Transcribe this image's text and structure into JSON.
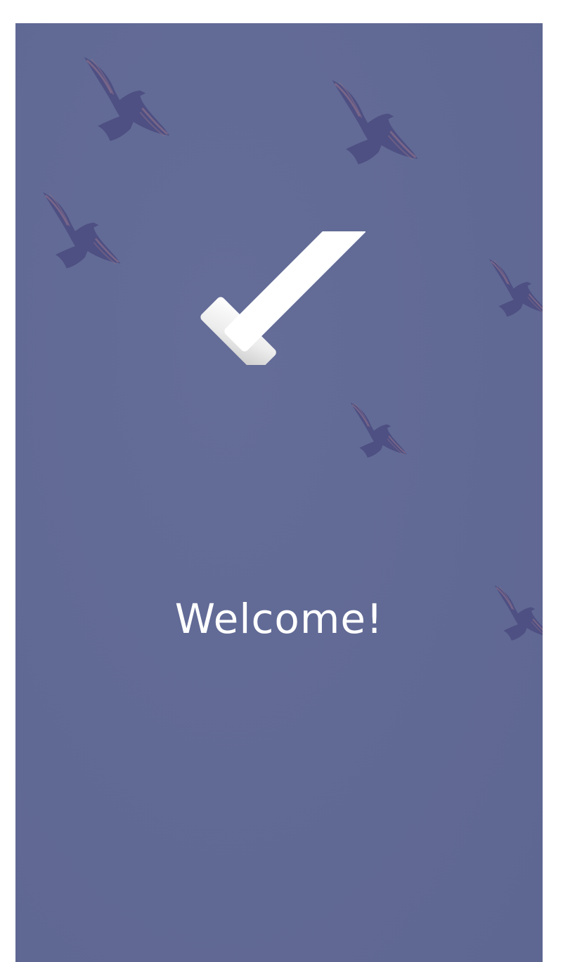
{
  "screen": {
    "background_color": "#616a96",
    "welcome_text": "Welcome!"
  },
  "icons": {
    "checkmark": "check-icon",
    "birds": "bird-icon"
  },
  "colors": {
    "checkmark": "#ffffff",
    "bird_body": "#4e4f82",
    "bird_wing_highlight": "#8a6f8a"
  }
}
